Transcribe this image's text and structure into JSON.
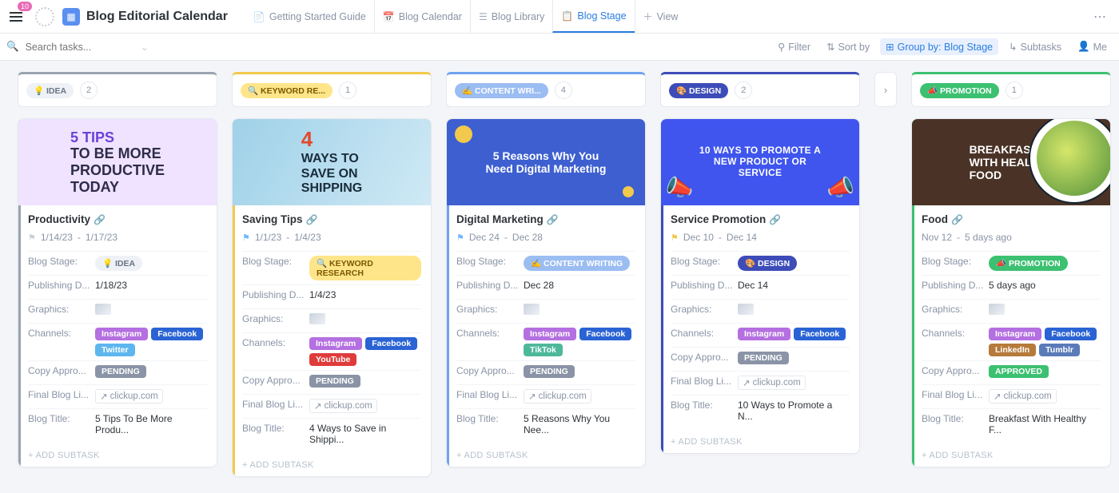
{
  "header": {
    "notifications": "10",
    "title": "Blog Editorial Calendar",
    "tabs": [
      {
        "label": "Getting Started Guide",
        "icon": "📄"
      },
      {
        "label": "Blog Calendar",
        "icon": "📅"
      },
      {
        "label": "Blog Library",
        "icon": "☰"
      },
      {
        "label": "Blog Stage",
        "icon": "📋",
        "active": true
      },
      {
        "label": "View",
        "icon": "＋"
      }
    ]
  },
  "toolbar": {
    "search_placeholder": "Search tasks...",
    "filter": "Filter",
    "sort": "Sort by",
    "group": "Group by: Blog Stage",
    "subtasks": "Subtasks",
    "me": "Me"
  },
  "labels": {
    "blog_stage": "Blog Stage:",
    "publishing": "Publishing D...",
    "graphics": "Graphics:",
    "channels": "Channels:",
    "copy": "Copy Appro...",
    "final": "Final Blog Li...",
    "title": "Blog Title:",
    "add_subtask": "+ ADD SUBTASK",
    "link_text": "clickup.com"
  },
  "columns": [
    {
      "id": "idea",
      "name": "IDEA",
      "icon": "💡",
      "count": "2",
      "head_color": "#9aa3af",
      "chip_bg": "#eef1f6",
      "chip_text": "#6b7485",
      "cards": [
        {
          "accent": "#9aa3af",
          "cover_class": "cov-1",
          "cover_html": "<b>5 TIPS</b><br>TO BE MORE<br>PRODUCTIVE<br>TODAY",
          "title": "Productivity",
          "flag": "#c8cfd9",
          "date_start": "1/14/23",
          "date_end": "1/17/23",
          "stage": {
            "label": "IDEA",
            "icon": "💡",
            "bg": "#eef1f6",
            "text": "#6b7485"
          },
          "publishing": "1/18/23",
          "channels": [
            "instagram",
            "facebook",
            "twitter"
          ],
          "copy": "PENDING",
          "copy_color": "gray",
          "blog_title": "5 Tips To Be More Produ..."
        }
      ]
    },
    {
      "id": "keyword",
      "name": "KEYWORD RE...",
      "icon": "🔍",
      "count": "1",
      "head_color": "#f2c94c",
      "chip_bg": "#ffe58a",
      "chip_text": "#7a5a00",
      "cards": [
        {
          "accent": "#f2c94c",
          "cover_class": "cov-2",
          "cover_html": "<span class='big'>4</span>WAYS TO<br>SAVE ON<br>SHIPPING",
          "title": "Saving Tips",
          "flag": "#6fb7ff",
          "date_start": "1/1/23",
          "date_end": "1/4/23",
          "stage": {
            "label": "KEYWORD RESEARCH",
            "icon": "🔍",
            "bg": "#ffe58a",
            "text": "#7a5a00"
          },
          "publishing": "1/4/23",
          "channels": [
            "instagram",
            "facebook",
            "youtube"
          ],
          "copy": "PENDING",
          "copy_color": "gray",
          "blog_title": "4 Ways to Save in Shippi..."
        }
      ]
    },
    {
      "id": "writing",
      "name": "CONTENT WRI...",
      "icon": "✍️",
      "count": "4",
      "head_color": "#6fa3ef",
      "chip_bg": "#9bbdf2",
      "chip_text": "#fff",
      "cards": [
        {
          "accent": "#6fa3ef",
          "cover_class": "cov-3",
          "cover_html": "5 Reasons Why You<br>Need Digital Marketing",
          "title": "Digital Marketing",
          "flag": "#6fb7ff",
          "date_start": "Dec 24",
          "date_end": "Dec 28",
          "stage": {
            "label": "CONTENT WRITING",
            "icon": "✍️",
            "bg": "#9bbdf2",
            "text": "#fff"
          },
          "publishing": "Dec 28",
          "channels": [
            "instagram",
            "facebook",
            "tiktok"
          ],
          "copy": "PENDING",
          "copy_color": "gray",
          "blog_title": "5 Reasons Why You Nee..."
        }
      ]
    },
    {
      "id": "design",
      "name": "DESIGN",
      "icon": "🎨",
      "count": "2",
      "head_color": "#3d4cb8",
      "chip_bg": "#3d4cb8",
      "chip_text": "#fff",
      "has_side_dots": true,
      "cards": [
        {
          "accent": "#3d4cb8",
          "cover_class": "cov-4",
          "cover_html": "10 WAYS TO PROMOTE A<br>NEW PRODUCT OR<br>SERVICE",
          "title": "Service Promotion",
          "flag": "#f2c94c",
          "date_start": "Dec 10",
          "date_end": "Dec 14",
          "stage": {
            "label": "DESIGN",
            "icon": "🎨",
            "bg": "#3d4cb8",
            "text": "#fff"
          },
          "publishing": "Dec 14",
          "channels": [
            "instagram",
            "facebook"
          ],
          "copy": "PENDING",
          "copy_color": "gray",
          "blog_title": "10 Ways to Promote a N..."
        }
      ]
    },
    {
      "id": "promotion",
      "name": "PROMOTION",
      "icon": "📣",
      "count": "1",
      "head_color": "#3cc071",
      "chip_bg": "#3cc071",
      "chip_text": "#fff",
      "has_side_dots": true,
      "cards": [
        {
          "accent": "#3cc071",
          "cover_class": "cov-5",
          "cover_html": "BREAKFAST<br>WITH HEALTHY<br>FOOD",
          "title": "Food",
          "flag": "",
          "date_start": "Nov 12",
          "date_end": "5 days ago",
          "stage": {
            "label": "PROMOTION",
            "icon": "📣",
            "bg": "#3cc071",
            "text": "#fff"
          },
          "publishing": "5 days ago",
          "channels": [
            "instagram",
            "facebook",
            "linkedin",
            "tumblr"
          ],
          "copy": "APPROVED",
          "copy_color": "green",
          "blog_title": "Breakfast With Healthy F..."
        }
      ]
    }
  ],
  "channel_labels": {
    "instagram": "Instagram",
    "facebook": "Facebook",
    "twitter": "Twitter",
    "youtube": "YouTube",
    "tiktok": "TikTok",
    "linkedin": "LinkedIn",
    "tumblr": "Tumblr"
  }
}
